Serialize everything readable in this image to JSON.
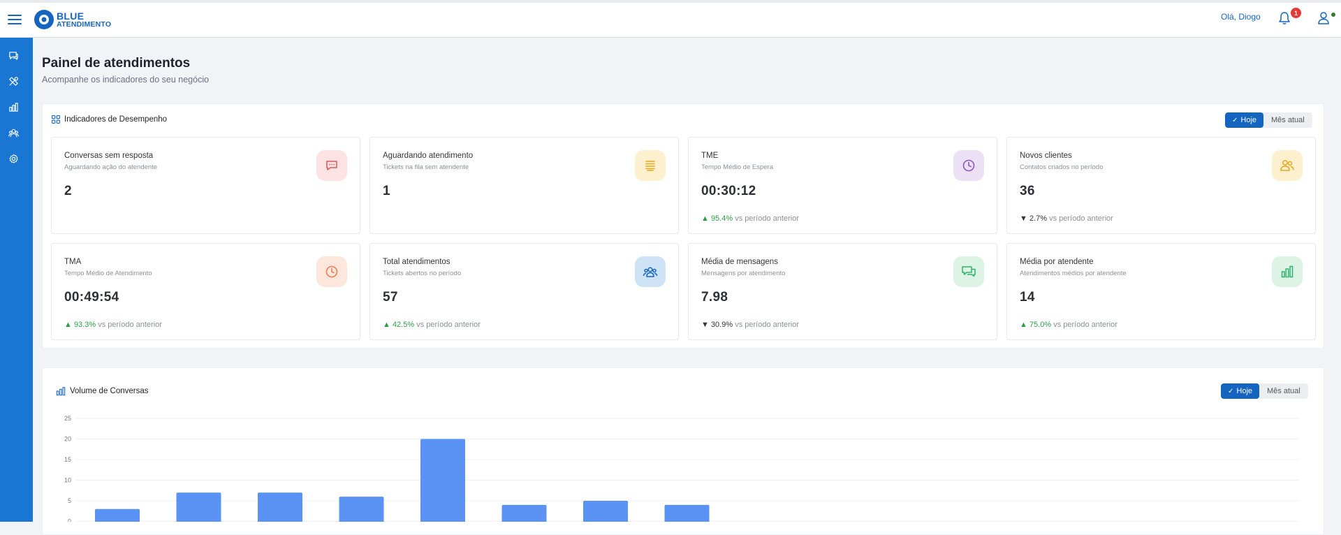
{
  "header": {
    "logo_line1": "BLUE",
    "logo_line2": "ATENDIMENTO",
    "greeting": "Olá, Diogo",
    "notification_count": "1"
  },
  "sidebar": {
    "items": [
      {
        "icon": "chat-icon"
      },
      {
        "icon": "tools-icon"
      },
      {
        "icon": "bar-chart-icon"
      },
      {
        "icon": "users-icon"
      },
      {
        "icon": "gear-icon"
      }
    ]
  },
  "page": {
    "title": "Painel de atendimentos",
    "subtitle": "Acompanhe os indicadores do seu negócio"
  },
  "kpi_panel": {
    "title": "Indicadores de Desempenho",
    "toggle_active": "Hoje",
    "toggle_inactive": "Mês atual",
    "cards": [
      {
        "title": "Conversas sem resposta",
        "subtitle": "Aguardando ação do atendente",
        "value": "2",
        "trend_dir": "",
        "trend_value": "",
        "trend_label": "",
        "icon": "chat-icon",
        "icon_bg": "#fde3e3",
        "icon_color": "#e0565b"
      },
      {
        "title": "Aguardando atendimento",
        "subtitle": "Tickets na fila sem atendente",
        "value": "1",
        "trend_dir": "",
        "trend_value": "",
        "trend_label": "",
        "icon": "queue-icon",
        "icon_bg": "#fdf0cf",
        "icon_color": "#e6a51b"
      },
      {
        "title": "TME",
        "subtitle": "Tempo Médio de Espera",
        "value": "00:30:12",
        "trend_dir": "up",
        "trend_value": "▲ 95.4%",
        "trend_label": " vs período anterior",
        "icon": "clock-icon",
        "icon_bg": "#ece0f5",
        "icon_color": "#8e55c0"
      },
      {
        "title": "Novos clientes",
        "subtitle": "Contatos criados no período",
        "value": "36",
        "trend_dir": "down",
        "trend_value": "▼ 2.7%",
        "trend_label": " vs período anterior",
        "icon": "users-icon",
        "icon_bg": "#fdf0cf",
        "icon_color": "#e6a51b"
      },
      {
        "title": "TMA",
        "subtitle": "Tempo Médio de Atendimento",
        "value": "00:49:54",
        "trend_dir": "up",
        "trend_value": "▲ 93.3%",
        "trend_label": " vs período anterior",
        "icon": "clock-icon",
        "icon_bg": "#fde6dc",
        "icon_color": "#ef7d52"
      },
      {
        "title": "Total atendimentos",
        "subtitle": "Tickets abertos no período",
        "value": "57",
        "trend_dir": "up",
        "trend_value": "▲ 42.5%",
        "trend_label": " vs período anterior",
        "icon": "team-icon",
        "icon_bg": "#cfe3f6",
        "icon_color": "#1565c0"
      },
      {
        "title": "Média de mensagens",
        "subtitle": "Mensagens por atendimento",
        "value": "7.98",
        "trend_dir": "down",
        "trend_value": "▼ 30.9%",
        "trend_label": " vs período anterior",
        "icon": "messages-icon",
        "icon_bg": "#dcf3e6",
        "icon_color": "#2fb36a"
      },
      {
        "title": "Média por atendente",
        "subtitle": "Atendimentos médios por atendente",
        "value": "14",
        "trend_dir": "up",
        "trend_value": "▲ 75.0%",
        "trend_label": " vs período anterior",
        "icon": "bar-chart-icon",
        "icon_bg": "#dcf3e6",
        "icon_color": "#2fb36a"
      }
    ]
  },
  "volume_panel": {
    "title": "Volume de Conversas",
    "toggle_active": "Hoje",
    "toggle_inactive": "Mês atual"
  },
  "chart_data": {
    "type": "bar",
    "title": "Volume de Conversas",
    "ylim": [
      0,
      25
    ],
    "yticks": [
      "25",
      "20",
      "15",
      "10",
      "5",
      "0"
    ],
    "values": [
      3,
      7,
      7,
      6,
      20,
      4,
      5,
      4
    ],
    "bar_color": "#5b93f5",
    "grid": true
  }
}
